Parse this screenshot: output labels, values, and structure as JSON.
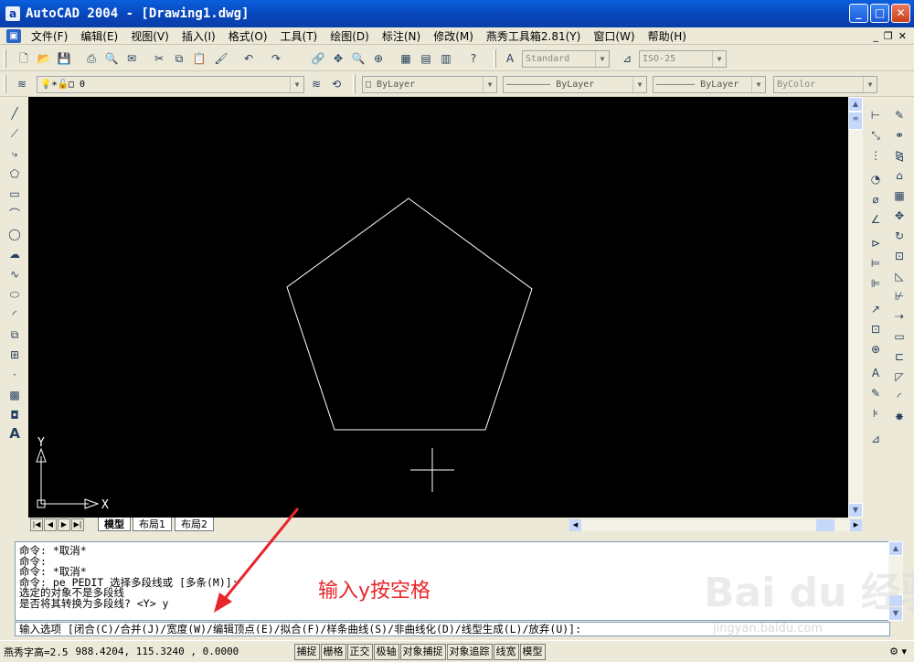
{
  "window": {
    "title": "AutoCAD 2004 - [Drawing1.dwg]",
    "app_icon": "a"
  },
  "menu": [
    "文件(F)",
    "编辑(E)",
    "视图(V)",
    "插入(I)",
    "格式(O)",
    "工具(T)",
    "绘图(D)",
    "标注(N)",
    "修改(M)",
    "燕秀工具箱2.81(Y)",
    "窗口(W)",
    "帮助(H)"
  ],
  "toolbar": {
    "text_style": "Standard",
    "dim_style": "ISO-25",
    "layer": "0",
    "color": "ByLayer",
    "linetype": "ByLayer",
    "lineweight": "ByLayer",
    "plotstyle": "ByColor"
  },
  "ucs": {
    "x_label": "X",
    "y_label": "Y"
  },
  "tabs": [
    "模型",
    "布局1",
    "布局2"
  ],
  "command": {
    "history": [
      "命令: *取消*",
      "命令:",
      "命令: *取消*",
      "命令: pe PEDIT 选择多段线或 [多条(M)]:",
      "选定的对象不是多段线",
      "是否将其转换为多段线? <Y> y"
    ],
    "prompt": "输入选项 [闭合(C)/合并(J)/宽度(W)/编辑顶点(E)/拟合(F)/样条曲线(S)/非曲线化(D)/线型生成(L)/放弃(U)]:"
  },
  "annotation": "输入y按空格",
  "status": {
    "text_height": "燕秀字高=2.5",
    "coords": "988.4204,  115.3240 , 0.0000",
    "buttons": [
      "捕捉",
      "栅格",
      "正交",
      "极轴",
      "对象捕捉",
      "对象追踪",
      "线宽",
      "模型"
    ]
  },
  "watermark": "Bai du 经验",
  "watermark_url": "jingyan.baidu.com",
  "colors": {
    "canvas": "#000000",
    "annotation": "#e8262a",
    "titlebar": "#0a5fdc"
  }
}
